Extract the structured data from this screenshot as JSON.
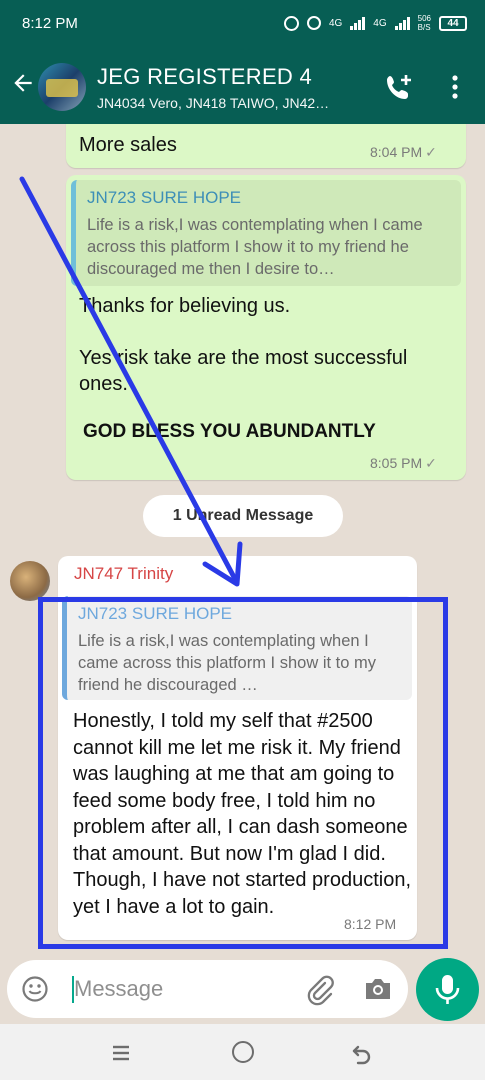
{
  "status_bar": {
    "time": "8:12 PM",
    "network_1": "4G",
    "network_2": "4G",
    "speed": "506",
    "speed_unit": "B/S",
    "battery": "44"
  },
  "header": {
    "title": "JEG REGISTERED 4",
    "subtitle": "JN4034 Vero, JN418 TAIWO, JN42…"
  },
  "messages": [
    {
      "text": "More sales",
      "time": "8:04 PM"
    },
    {
      "quote": {
        "name": "JN723 SURE HOPE",
        "text": "Life is a risk,I was contemplating when I came across this platform I show it to my friend he discouraged me    then I desire to…"
      },
      "text": "Thanks for believing us.\n\nYes risk take are the most successful ones.",
      "bold_text": "GOD BLESS YOU ABUNDANTLY",
      "time": "8:05 PM"
    }
  ],
  "unread_banner": "1 Unread Message",
  "incoming": {
    "sender": "JN747 Trinity",
    "quote": {
      "name": "JN723 SURE HOPE",
      "text": "Life is a risk,I was contemplating when I came across this platform I show it to my friend he discouraged …"
    },
    "text": "Honestly, I told my self that #2500 cannot kill me let me risk it. My friend was laughing at me that am going to feed some body free, I told him no problem after all, I can dash someone that amount. But now I'm glad I did. Though, I have not started production, yet I have a lot to gain.",
    "time": "8:12 PM"
  },
  "composer": {
    "placeholder": "Message"
  },
  "colors": {
    "header": "#075e54",
    "outgoing": "#dcf8c6",
    "accent": "#00a884",
    "annotation": "#2a3ae6"
  },
  "icons": [
    "back-arrow-icon",
    "add-call-icon",
    "more-vert-icon",
    "emoji-icon",
    "attach-icon",
    "camera-icon",
    "mic-icon",
    "nav-recent-icon",
    "nav-home-icon",
    "nav-back-icon"
  ]
}
